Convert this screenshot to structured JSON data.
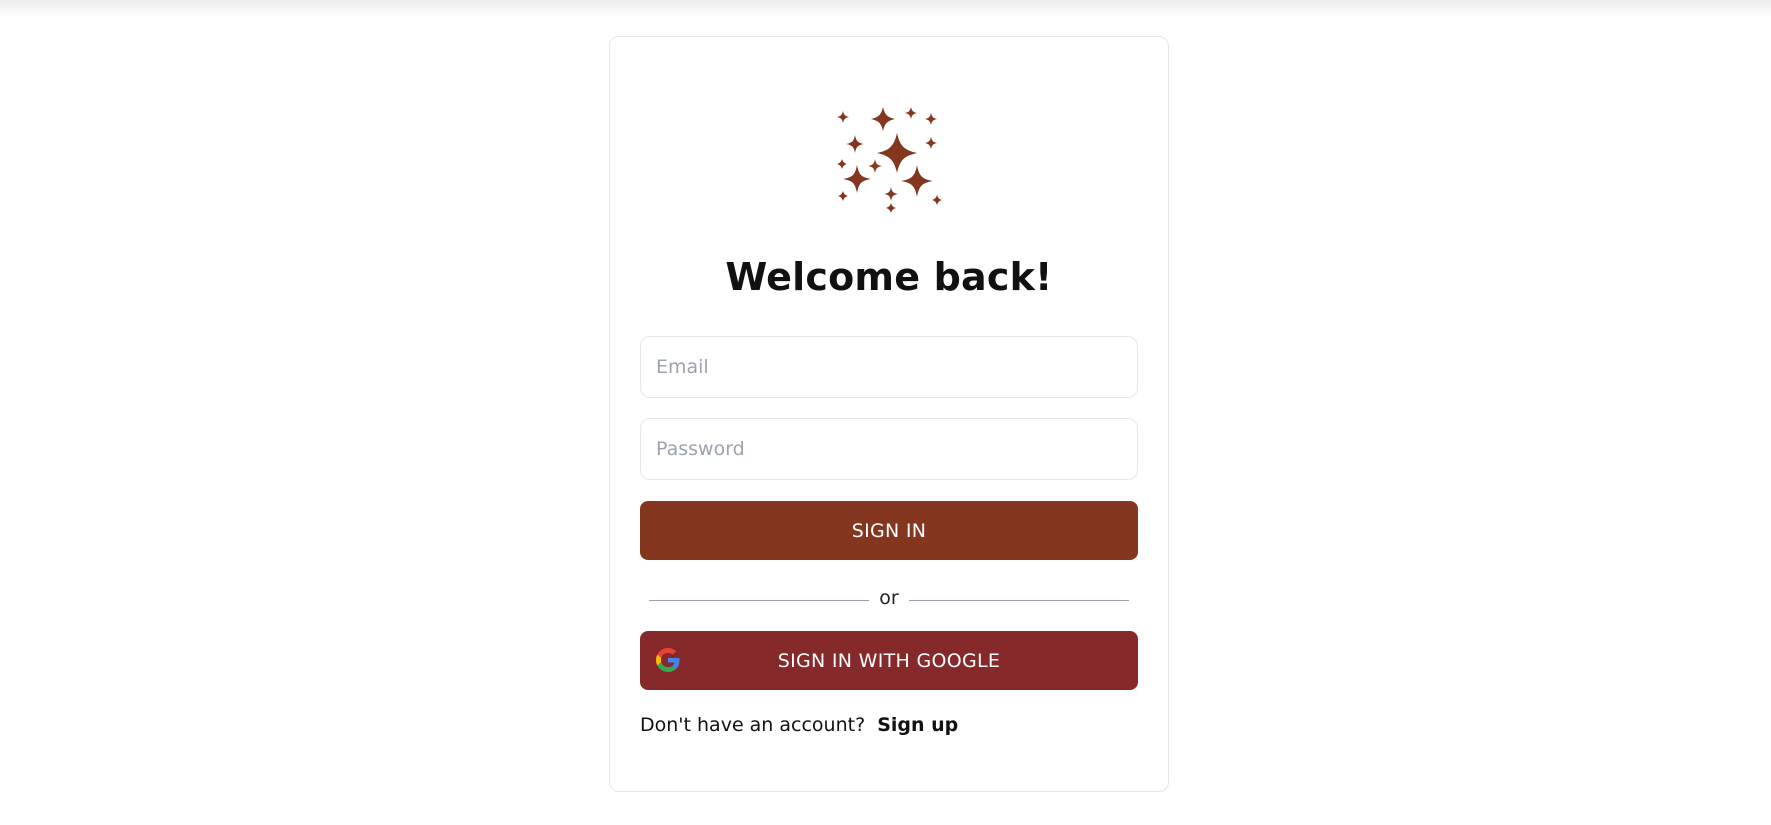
{
  "login": {
    "title": "Welcome back!",
    "email_placeholder": "Email",
    "password_placeholder": "Password",
    "signin_label": "SIGN IN",
    "divider_text": "or",
    "google_label": "SIGN IN WITH GOOGLE",
    "no_account_text": "Don't have an account?",
    "signup_label": "Sign up"
  },
  "icons": {
    "logo": "sparkles-icon",
    "google": "google-icon"
  },
  "colors": {
    "primary": "#84361f",
    "google_button": "#86292b",
    "border": "#e5e7eb",
    "placeholder": "#9ca3af"
  }
}
